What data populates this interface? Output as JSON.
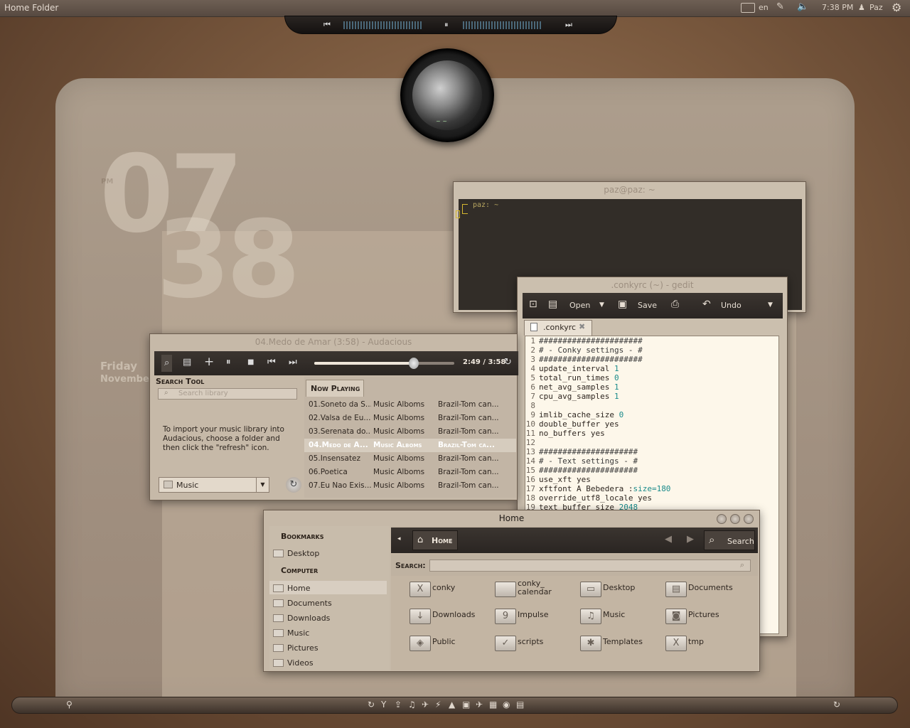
{
  "top_panel": {
    "title": "Home Folder",
    "kbd": "en",
    "time": "7:38 PM",
    "user": "Paz",
    "icons": {
      "keyboard": "keyboard-icon",
      "pen": "pen-icon",
      "volume": "volume-icon",
      "user": "user-icon",
      "gear": "gear-icon"
    }
  },
  "media_bar": {
    "prev": "⏮",
    "pause": "⏸",
    "next": "⏭"
  },
  "clock": {
    "ampm": "PM",
    "hour": "07",
    "minute": "38",
    "day": "Friday",
    "month": "November"
  },
  "terminal": {
    "title": "paz@paz: ~",
    "prompt": "paz: ~"
  },
  "gedit": {
    "title": ".conkyrc (~) - gedit",
    "toolbar": {
      "open": "Open",
      "save": "Save",
      "undo": "Undo"
    },
    "tab": ".conkyrc",
    "lines": [
      {
        "n": "1",
        "t": "######################"
      },
      {
        "n": "2",
        "t": "# - Conky settings - #"
      },
      {
        "n": "3",
        "t": "######################"
      },
      {
        "n": "4",
        "t": "update_interval ",
        "v": "1"
      },
      {
        "n": "5",
        "t": "total_run_times ",
        "v": "0"
      },
      {
        "n": "6",
        "t": "net_avg_samples ",
        "v": "1"
      },
      {
        "n": "7",
        "t": "cpu_avg_samples ",
        "v": "1"
      },
      {
        "n": "8",
        "t": ""
      },
      {
        "n": "9",
        "t": "imlib_cache_size ",
        "v": "0"
      },
      {
        "n": "10",
        "t": "double_buffer yes"
      },
      {
        "n": "11",
        "t": "no_buffers yes"
      },
      {
        "n": "12",
        "t": ""
      },
      {
        "n": "13",
        "t": "#####################"
      },
      {
        "n": "14",
        "t": "# - Text settings - #"
      },
      {
        "n": "15",
        "t": "#####################"
      },
      {
        "n": "16",
        "t": "use_xft yes"
      },
      {
        "n": "17",
        "t": "xftfont A Bebedera :",
        "v": "size=180"
      },
      {
        "n": "18",
        "t": "override_utf8_locale yes"
      },
      {
        "n": "19",
        "t": "text_buffer_size ",
        "v": "2048"
      }
    ]
  },
  "audacious": {
    "title": "04.Medo de Amar (3:58) - Audacious",
    "time": "2:49 / 3:58",
    "progress": 0.71,
    "search_tool": "Search Tool",
    "search_placeholder": "Search library",
    "help": "To import your music library into Audacious, choose a folder and then click the \"refresh\" icon.",
    "combo": "Music",
    "playlist_tab": "Now Playing",
    "tracks": [
      {
        "title": "01.Soneto da S...",
        "album": "Music Alboms",
        "artist": "Brazil-Tom can..."
      },
      {
        "title": "02.Valsa de Eu...",
        "album": "Music Alboms",
        "artist": "Brazil-Tom can..."
      },
      {
        "title": "03.Serenata do...",
        "album": "Music Alboms",
        "artist": "Brazil-Tom can..."
      },
      {
        "title": "04.Medo de A...",
        "album": "Music Alboms",
        "artist": "Brazil-Tom ca...",
        "selected": true
      },
      {
        "title": "05.Insensatez",
        "album": "Music Alboms",
        "artist": "Brazil-Tom can..."
      },
      {
        "title": "06.Poetica",
        "album": "Music Alboms",
        "artist": "Brazil-Tom can..."
      },
      {
        "title": "07.Eu Nao Exis...",
        "album": "Music Alboms",
        "artist": "Brazil-Tom can..."
      }
    ]
  },
  "nautilus": {
    "title": "Home",
    "bookmarks_header": "Bookmarks",
    "bookmarks": [
      "Desktop"
    ],
    "computer_header": "Computer",
    "places": [
      "Home",
      "Documents",
      "Downloads",
      "Music",
      "Pictures",
      "Videos"
    ],
    "location": "Home",
    "search_btn": "Search",
    "search_label": "Search:",
    "files": [
      {
        "name": "conky",
        "icon": "X"
      },
      {
        "name": "conky_\ncalendar",
        "icon": ""
      },
      {
        "name": "Desktop",
        "icon": "▭"
      },
      {
        "name": "Documents",
        "icon": "▤"
      },
      {
        "name": "Downloads",
        "icon": "↓"
      },
      {
        "name": "Impulse",
        "icon": "9"
      },
      {
        "name": "Music",
        "icon": "♫"
      },
      {
        "name": "Pictures",
        "icon": "◙"
      },
      {
        "name": "Public",
        "icon": "◈"
      },
      {
        "name": "scripts",
        "icon": "✓"
      },
      {
        "name": "Templates",
        "icon": "✱"
      },
      {
        "name": "tmp",
        "icon": "X"
      }
    ]
  },
  "dock": {
    "icons": [
      "↻",
      "Y",
      "⇪",
      "♫",
      "✈",
      "⚡",
      "▲",
      "▣",
      "✈",
      "▦",
      "◉",
      "▤"
    ]
  }
}
